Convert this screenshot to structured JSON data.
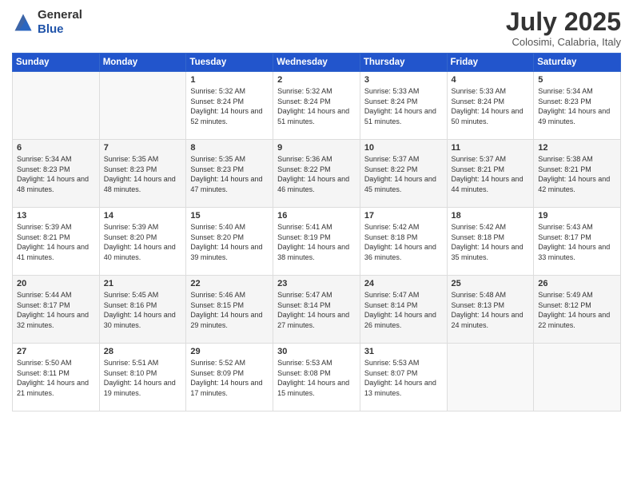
{
  "header": {
    "logo_general": "General",
    "logo_blue": "Blue",
    "month_title": "July 2025",
    "subtitle": "Colosimi, Calabria, Italy"
  },
  "weekdays": [
    "Sunday",
    "Monday",
    "Tuesday",
    "Wednesday",
    "Thursday",
    "Friday",
    "Saturday"
  ],
  "weeks": [
    [
      {
        "day": "",
        "sunrise": "",
        "sunset": "",
        "daylight": "",
        "empty": true
      },
      {
        "day": "",
        "sunrise": "",
        "sunset": "",
        "daylight": "",
        "empty": true
      },
      {
        "day": "1",
        "sunrise": "Sunrise: 5:32 AM",
        "sunset": "Sunset: 8:24 PM",
        "daylight": "Daylight: 14 hours and 52 minutes.",
        "empty": false
      },
      {
        "day": "2",
        "sunrise": "Sunrise: 5:32 AM",
        "sunset": "Sunset: 8:24 PM",
        "daylight": "Daylight: 14 hours and 51 minutes.",
        "empty": false
      },
      {
        "day": "3",
        "sunrise": "Sunrise: 5:33 AM",
        "sunset": "Sunset: 8:24 PM",
        "daylight": "Daylight: 14 hours and 51 minutes.",
        "empty": false
      },
      {
        "day": "4",
        "sunrise": "Sunrise: 5:33 AM",
        "sunset": "Sunset: 8:24 PM",
        "daylight": "Daylight: 14 hours and 50 minutes.",
        "empty": false
      },
      {
        "day": "5",
        "sunrise": "Sunrise: 5:34 AM",
        "sunset": "Sunset: 8:23 PM",
        "daylight": "Daylight: 14 hours and 49 minutes.",
        "empty": false
      }
    ],
    [
      {
        "day": "6",
        "sunrise": "Sunrise: 5:34 AM",
        "sunset": "Sunset: 8:23 PM",
        "daylight": "Daylight: 14 hours and 48 minutes.",
        "empty": false
      },
      {
        "day": "7",
        "sunrise": "Sunrise: 5:35 AM",
        "sunset": "Sunset: 8:23 PM",
        "daylight": "Daylight: 14 hours and 48 minutes.",
        "empty": false
      },
      {
        "day": "8",
        "sunrise": "Sunrise: 5:35 AM",
        "sunset": "Sunset: 8:23 PM",
        "daylight": "Daylight: 14 hours and 47 minutes.",
        "empty": false
      },
      {
        "day": "9",
        "sunrise": "Sunrise: 5:36 AM",
        "sunset": "Sunset: 8:22 PM",
        "daylight": "Daylight: 14 hours and 46 minutes.",
        "empty": false
      },
      {
        "day": "10",
        "sunrise": "Sunrise: 5:37 AM",
        "sunset": "Sunset: 8:22 PM",
        "daylight": "Daylight: 14 hours and 45 minutes.",
        "empty": false
      },
      {
        "day": "11",
        "sunrise": "Sunrise: 5:37 AM",
        "sunset": "Sunset: 8:21 PM",
        "daylight": "Daylight: 14 hours and 44 minutes.",
        "empty": false
      },
      {
        "day": "12",
        "sunrise": "Sunrise: 5:38 AM",
        "sunset": "Sunset: 8:21 PM",
        "daylight": "Daylight: 14 hours and 42 minutes.",
        "empty": false
      }
    ],
    [
      {
        "day": "13",
        "sunrise": "Sunrise: 5:39 AM",
        "sunset": "Sunset: 8:21 PM",
        "daylight": "Daylight: 14 hours and 41 minutes.",
        "empty": false
      },
      {
        "day": "14",
        "sunrise": "Sunrise: 5:39 AM",
        "sunset": "Sunset: 8:20 PM",
        "daylight": "Daylight: 14 hours and 40 minutes.",
        "empty": false
      },
      {
        "day": "15",
        "sunrise": "Sunrise: 5:40 AM",
        "sunset": "Sunset: 8:20 PM",
        "daylight": "Daylight: 14 hours and 39 minutes.",
        "empty": false
      },
      {
        "day": "16",
        "sunrise": "Sunrise: 5:41 AM",
        "sunset": "Sunset: 8:19 PM",
        "daylight": "Daylight: 14 hours and 38 minutes.",
        "empty": false
      },
      {
        "day": "17",
        "sunrise": "Sunrise: 5:42 AM",
        "sunset": "Sunset: 8:18 PM",
        "daylight": "Daylight: 14 hours and 36 minutes.",
        "empty": false
      },
      {
        "day": "18",
        "sunrise": "Sunrise: 5:42 AM",
        "sunset": "Sunset: 8:18 PM",
        "daylight": "Daylight: 14 hours and 35 minutes.",
        "empty": false
      },
      {
        "day": "19",
        "sunrise": "Sunrise: 5:43 AM",
        "sunset": "Sunset: 8:17 PM",
        "daylight": "Daylight: 14 hours and 33 minutes.",
        "empty": false
      }
    ],
    [
      {
        "day": "20",
        "sunrise": "Sunrise: 5:44 AM",
        "sunset": "Sunset: 8:17 PM",
        "daylight": "Daylight: 14 hours and 32 minutes.",
        "empty": false
      },
      {
        "day": "21",
        "sunrise": "Sunrise: 5:45 AM",
        "sunset": "Sunset: 8:16 PM",
        "daylight": "Daylight: 14 hours and 30 minutes.",
        "empty": false
      },
      {
        "day": "22",
        "sunrise": "Sunrise: 5:46 AM",
        "sunset": "Sunset: 8:15 PM",
        "daylight": "Daylight: 14 hours and 29 minutes.",
        "empty": false
      },
      {
        "day": "23",
        "sunrise": "Sunrise: 5:47 AM",
        "sunset": "Sunset: 8:14 PM",
        "daylight": "Daylight: 14 hours and 27 minutes.",
        "empty": false
      },
      {
        "day": "24",
        "sunrise": "Sunrise: 5:47 AM",
        "sunset": "Sunset: 8:14 PM",
        "daylight": "Daylight: 14 hours and 26 minutes.",
        "empty": false
      },
      {
        "day": "25",
        "sunrise": "Sunrise: 5:48 AM",
        "sunset": "Sunset: 8:13 PM",
        "daylight": "Daylight: 14 hours and 24 minutes.",
        "empty": false
      },
      {
        "day": "26",
        "sunrise": "Sunrise: 5:49 AM",
        "sunset": "Sunset: 8:12 PM",
        "daylight": "Daylight: 14 hours and 22 minutes.",
        "empty": false
      }
    ],
    [
      {
        "day": "27",
        "sunrise": "Sunrise: 5:50 AM",
        "sunset": "Sunset: 8:11 PM",
        "daylight": "Daylight: 14 hours and 21 minutes.",
        "empty": false
      },
      {
        "day": "28",
        "sunrise": "Sunrise: 5:51 AM",
        "sunset": "Sunset: 8:10 PM",
        "daylight": "Daylight: 14 hours and 19 minutes.",
        "empty": false
      },
      {
        "day": "29",
        "sunrise": "Sunrise: 5:52 AM",
        "sunset": "Sunset: 8:09 PM",
        "daylight": "Daylight: 14 hours and 17 minutes.",
        "empty": false
      },
      {
        "day": "30",
        "sunrise": "Sunrise: 5:53 AM",
        "sunset": "Sunset: 8:08 PM",
        "daylight": "Daylight: 14 hours and 15 minutes.",
        "empty": false
      },
      {
        "day": "31",
        "sunrise": "Sunrise: 5:53 AM",
        "sunset": "Sunset: 8:07 PM",
        "daylight": "Daylight: 14 hours and 13 minutes.",
        "empty": false
      },
      {
        "day": "",
        "sunrise": "",
        "sunset": "",
        "daylight": "",
        "empty": true
      },
      {
        "day": "",
        "sunrise": "",
        "sunset": "",
        "daylight": "",
        "empty": true
      }
    ]
  ]
}
